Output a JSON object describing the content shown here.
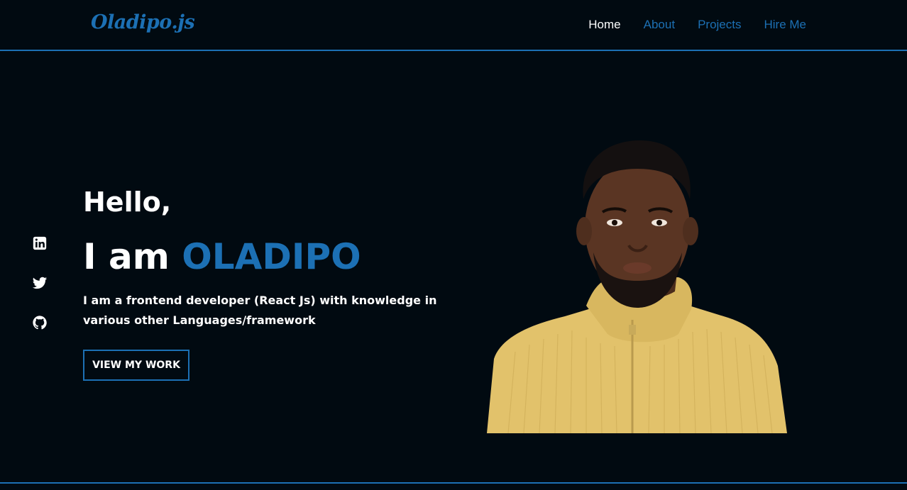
{
  "brand": {
    "logo": "Oladipo.js"
  },
  "nav": {
    "items": [
      {
        "label": "Home",
        "active": true
      },
      {
        "label": "About",
        "active": false
      },
      {
        "label": "Projects",
        "active": false
      },
      {
        "label": "Hire Me",
        "active": false
      }
    ]
  },
  "socials": [
    {
      "icon": "linkedin-icon"
    },
    {
      "icon": "twitter-icon"
    },
    {
      "icon": "github-icon"
    }
  ],
  "hero": {
    "greeting": "Hello,",
    "intro_prefix": "I am",
    "name": "OLADIPO",
    "description": "I am a frontend developer (React Js) with knowledge in various other Languages/framework",
    "cta_label": "VIEW MY WORK"
  },
  "colors": {
    "accent": "#1c70b4",
    "background": "#010a11",
    "text": "#ffffff",
    "sweater": "#e5c46c"
  }
}
